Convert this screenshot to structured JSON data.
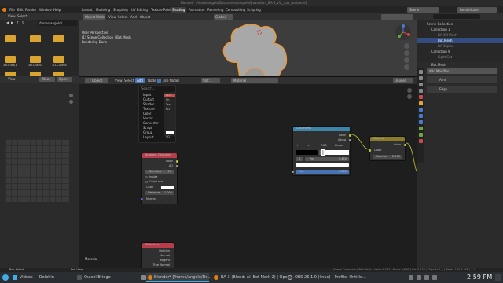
{
  "window_title": "Blender* [/home/angelo/Documents/angelo/Quandium_BA-2_v1__cax_tut.blend]",
  "top_menu": [
    "File",
    "Edit",
    "Render",
    "Window",
    "Help"
  ],
  "workspace_tabs": [
    "Layout",
    "Modeling",
    "Sculpting",
    "UV Editing",
    "Texture Paint",
    "Shading",
    "Animation",
    "Rendering",
    "Compositing",
    "Scripting"
  ],
  "active_workspace": "Shading",
  "scene_field": "Scene",
  "view_layer_field": "RenderLayer",
  "file_browser": {
    "menu": [
      "View",
      "Select"
    ],
    "path": "/home/angelo/",
    "folders": [
      {
        "label": ""
      },
      {
        "label": ""
      },
      {
        "label": ""
      },
      {
        "label": ""
      },
      {
        "label": ""
      },
      {
        "label": ""
      },
      {
        "label": "3D-Cust/1"
      },
      {
        "label": "3D-CustV4"
      },
      {
        "label": "3D-CustV8"
      },
      {
        "label": ""
      },
      {
        "label": ""
      },
      {
        "label": ""
      }
    ]
  },
  "image_editor": {
    "menu": [
      "View",
      "New",
      "Open"
    ]
  },
  "viewport": {
    "mode": "Object Mode",
    "menu": [
      "View",
      "Select",
      "Add",
      "Object"
    ],
    "overlay_line1": "User Perspective",
    "overlay_line2": "(1) Scene Collection | Bot.Mesh",
    "overlay_line3": "Rendering Done",
    "transform": "Global"
  },
  "outliner": {
    "root": "Scene Collection",
    "items": [
      "Collection 1",
      "BA-3M-Mesh",
      "Bot.Mesh",
      "BA-3Spine",
      "Collection 9",
      "Light.Cut"
    ]
  },
  "properties": {
    "object_name": "Bot.Mesh",
    "add_modifier": "Add Modifier",
    "modifier1": "Arm",
    "modifier2": "Edge"
  },
  "node_editor": {
    "mode": "Object",
    "menu": [
      "View",
      "Select",
      "Add",
      "Node"
    ],
    "use_nodes_label": "Use Nodes",
    "slot": "Slot 1",
    "material": "Material",
    "object_toggle": "Unused",
    "footer_label": "Material",
    "search_label": "Search...",
    "add_menu": [
      "Input",
      "Output",
      "Shader",
      "Texture",
      "Color",
      "Vector",
      "Converter",
      "Script",
      "Group",
      "Layout"
    ],
    "add_menu_right": [
      "AOV",
      "Sh",
      "Tex",
      "RO",
      "",
      "",
      "",
      "",
      "",
      "SO"
    ],
    "ao_node": {
      "title": "Ambient Occlusion",
      "outputs": [
        "Color",
        "AO"
      ],
      "samples_label": "Samples",
      "samples_value": "16",
      "inside": "Inside",
      "only_local": "Only Local",
      "color_label": "Color",
      "distance_label": "Distance",
      "distance_value": "1.000",
      "normal": "Normal"
    },
    "color_ramp": {
      "title": "ColorRamp",
      "outputs": [
        "Color",
        "Alpha"
      ],
      "mode": "RGB",
      "interp": "Linear",
      "index": "0",
      "pos_label": "Pos",
      "pos_value": "0.450",
      "fac_label": "Fac",
      "fac_value": "0.000"
    },
    "gamma_node": {
      "title": "Gamma",
      "output": "Color",
      "input_color": "Color",
      "gamma_label": "Gamma",
      "gamma_value": "2.200"
    },
    "geometry_node": {
      "title": "Geometry",
      "outputs": [
        "Position",
        "Normal",
        "Tangent",
        "True Normal"
      ]
    }
  },
  "status_bar": {
    "left": "Box Select",
    "mid": "Pan View",
    "right": "Scene Collection | Bot.Mesh | Verts 0,333 | Faces 0,616 | Tris 0,436 | Objects 1,1 | Mem: 165.8 MiB | 2.9"
  },
  "taskbar": {
    "items": [
      "Videos — Dolphin",
      "Quixel Bridge",
      "Screenshot — Spectacle",
      "Blender* [/home/angelo/Do…",
      "BA-3 (Blend: All Bot Mark 2) | Open…",
      "OBS 26.1.0 (linux) - Profile: Untitle…"
    ],
    "clock": "2:59 PM"
  },
  "colors": {
    "accent_blue": "#4772b3",
    "ao_header": "#b83c4a",
    "ramp_header": "#3c84a8",
    "gamma_header": "#8a7a2a",
    "geometry_header": "#b83c4a",
    "selection_orange": "#e89a3c"
  }
}
